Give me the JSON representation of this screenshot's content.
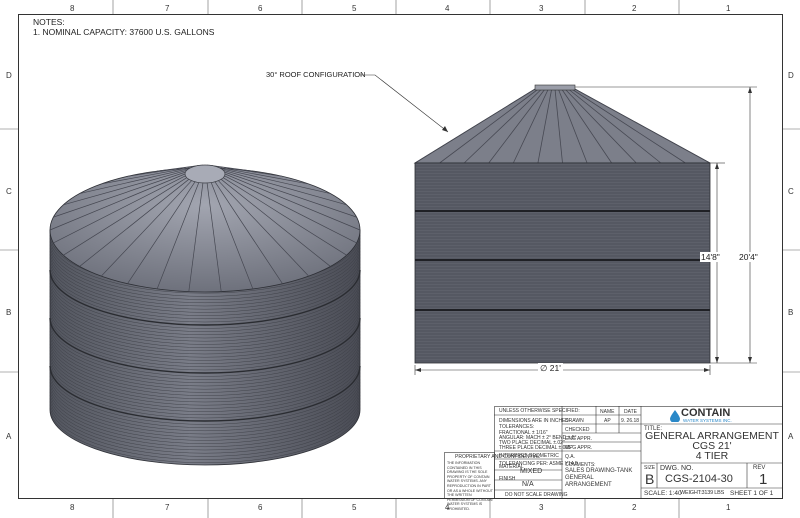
{
  "zones": {
    "top": [
      "8",
      "7",
      "6",
      "5",
      "4",
      "3",
      "2",
      "1"
    ],
    "bottom": [
      "8",
      "7",
      "6",
      "5",
      "4",
      "3",
      "2",
      "1"
    ],
    "left": [
      "D",
      "C",
      "B",
      "A"
    ],
    "right": [
      "D",
      "C",
      "B",
      "A"
    ]
  },
  "notes": {
    "heading": "NOTES:",
    "item1": "1.    NOMINAL CAPACITY: 37600 U.S. GALLONS"
  },
  "callout": {
    "roof": "30° ROOF CONFIGURATION"
  },
  "dimensions": {
    "height_overall": "20'4\"",
    "height_wall": "14'8\"",
    "diameter": "∅ 21'"
  },
  "title_block": {
    "unless_specified": "UNLESS OTHERWISE SPECIFIED:",
    "dims_inches": "DIMENSIONS ARE IN INCHES",
    "tolerances": "TOLERANCES:",
    "fractional": "FRACTIONAL ± 1/16\"",
    "angular": "ANGULAR: MACH ± 2° BEND ± 5°",
    "two_place": "TWO PLACE DECIMAL    ±.02\"",
    "three_place": "THREE PLACE DECIMAL   ±.005\"",
    "interpret": "INTERPRET GEOMETRIC",
    "tolerancing": "TOLERANCING PER: ASME Y14.5",
    "material_label": "MATERIAL",
    "material_value": "MIXED",
    "finish_label": "FINISH",
    "finish_value": "N/A",
    "do_not_scale": "DO NOT SCALE DRAWING",
    "col_name": "NAME",
    "col_date": "DATE",
    "drawn": "DRAWN",
    "drawn_name": "AP",
    "drawn_date": "9. 26.18",
    "checked": "CHECKED",
    "eng_appr": "ENG APPR.",
    "mfg_appr": "MFG APPR.",
    "qa": "Q.A.",
    "comments": "COMMENTS:",
    "comments_value": "SALES DRAWING-TANK GENERAL ARRANGEMENT",
    "proprietary": "PROPRIETARY AND CONFIDENTIAL",
    "proprietary_text": "THE INFORMATION CONTAINED IN THIS DRAWING IS THE SOLE PROPERTY OF CONTAIN WATER SYSTEMS. ANY REPRODUCTION IN PART OR AS A WHOLE WITHOUT THE WRITTEN PERMISSION OF CONTAIN WATER SYSTEMS IS PROHIBITED.",
    "logo_name": "CONTAIN",
    "logo_sub": "WATER SYSTEMS INC.",
    "title_label": "TITLE:",
    "title_line1": "GENERAL ARRANGEMENT",
    "title_line2": "CGS 21'",
    "title_line3": "4 TIER",
    "size_label": "SIZE",
    "size_value": "B",
    "dwg_label": "DWG.  NO.",
    "dwg_value": "CGS-2104-30",
    "rev_label": "REV",
    "rev_value": "1",
    "scale": "SCALE: 1:40",
    "weight": "WEIGHT:3139 LBS",
    "sheet": "SHEET 1 OF 1"
  },
  "colors": {
    "tank_side": "#6b6e78",
    "tank_roof": "#8a8d98",
    "tank_dark": "#3e4048",
    "logo": "#2a88c8"
  }
}
